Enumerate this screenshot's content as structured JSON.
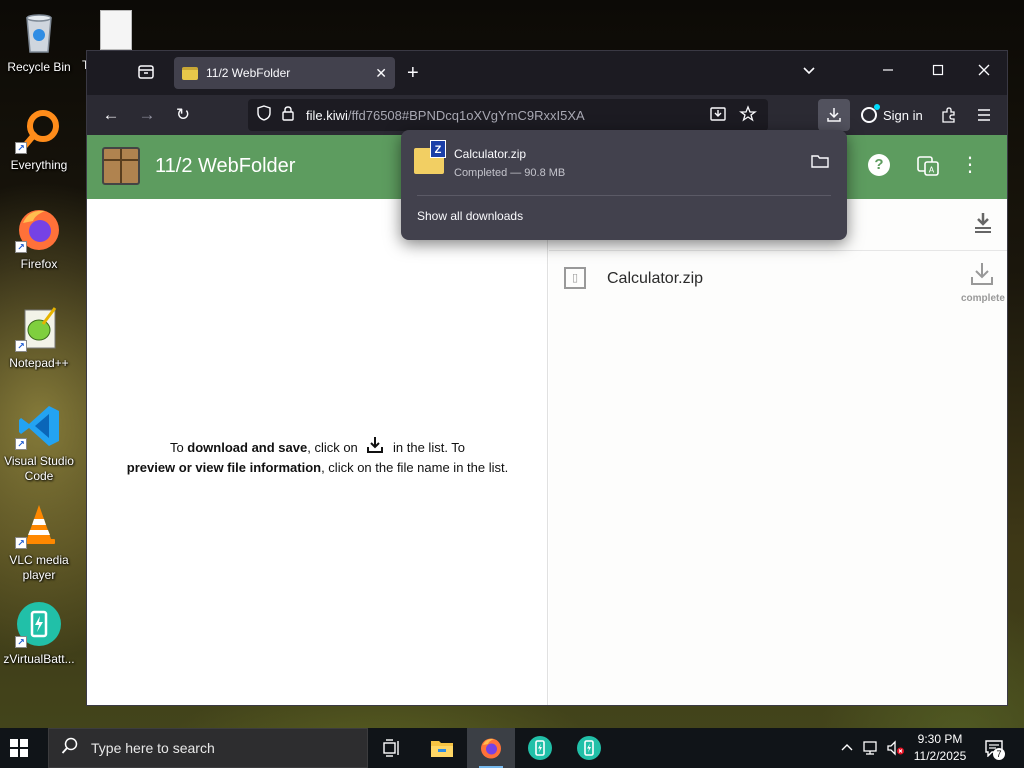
{
  "desktop": {
    "icons": [
      {
        "label": "Recycle Bin",
        "icon": "recycle-bin-icon"
      },
      {
        "label": "Everything",
        "icon": "everything-search-icon"
      },
      {
        "label": "Firefox",
        "icon": "firefox-icon"
      },
      {
        "label": "Notepad++",
        "icon": "notepad-plus-plus-icon"
      },
      {
        "label": "Visual Studio Code",
        "icon": "vscode-icon"
      },
      {
        "label": "VLC media player",
        "icon": "vlc-icon"
      },
      {
        "label": "zVirtualBatt...",
        "icon": "virtual-battery-icon"
      }
    ],
    "partial_label": "T"
  },
  "browser": {
    "tab_title": "11/2 WebFolder",
    "url_host": "file.kiwi",
    "url_rest": "/ffd76508#BPNDcq1oXVgYmC9RxxI5XA",
    "sign_in": "Sign in",
    "accent": "#00ddff"
  },
  "app": {
    "title": "11/2 WebFolder",
    "header_color": "#5d9c5f",
    "hint": {
      "t1": "To ",
      "b1": "download and save",
      "t2": ", click on ",
      "t3": " in the list. To",
      "b2": "preview or view file information",
      "t4": ", click on the file name in the list."
    },
    "files": [
      {
        "name": "Calculator.zip",
        "status": "complete"
      }
    ]
  },
  "downloads_panel": {
    "items": [
      {
        "name": "Calculator.zip",
        "status": "Completed — 90.8 MB"
      }
    ],
    "show_all": "Show all downloads"
  },
  "taskbar": {
    "search_placeholder": "Type here to search",
    "time": "9:30 PM",
    "date": "11/2/2025",
    "notification_count": "7"
  }
}
